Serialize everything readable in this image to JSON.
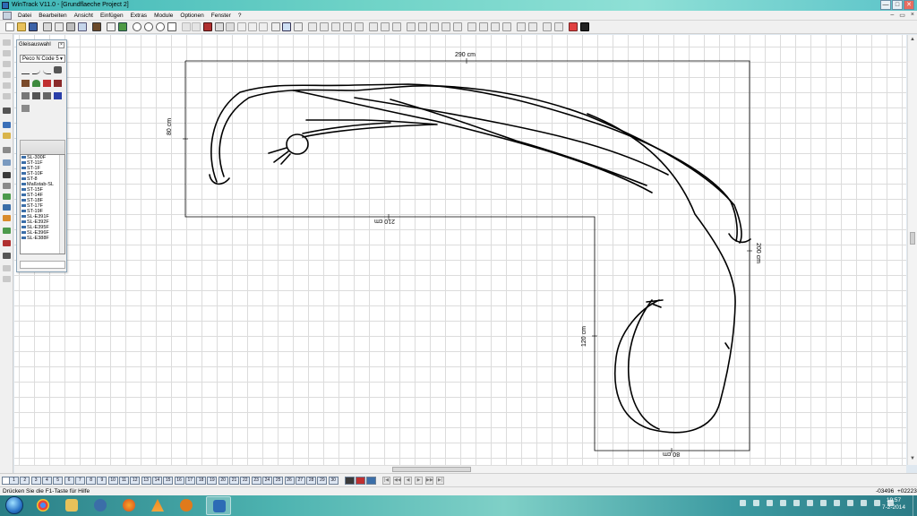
{
  "window": {
    "title": "WinTrack  V11.0 - [Grundflaeche Project 2]",
    "controls": {
      "minimize": "—",
      "maximize": "□",
      "close": "✕"
    }
  },
  "menu": {
    "items": [
      "Datei",
      "Bearbeiten",
      "Ansicht",
      "Einfügen",
      "Extras",
      "Module",
      "Optionen",
      "Fenster",
      "?"
    ],
    "child_controls": {
      "minimize": "–",
      "restore": "▭",
      "close": "×"
    }
  },
  "panel": {
    "title": "Gleisauswahl",
    "close": "×",
    "catalog": "Peco N Code 5",
    "catalog_caret": "▼",
    "track_items": [
      "SL-300F",
      "ST-11F",
      "ST-1F",
      "ST-10F",
      "ST-8",
      "Maßstab-SL",
      "ST-15F",
      "ST-14F",
      "ST-18F",
      "ST-17F",
      "ST-19F",
      "SL-E391F",
      "SL-E392F",
      "SL-E395F",
      "SL-E396F",
      "SL-E388F"
    ]
  },
  "canvas": {
    "dim_top": "290 cm",
    "dim_left": "80 cm",
    "dim_inner": "210 cm",
    "dim_right": "200 cm",
    "dim_leg": "120 cm",
    "dim_bottom": "80 cm"
  },
  "module_tabs": [
    "1",
    "2",
    "3",
    "4",
    "5",
    "6",
    "7",
    "8",
    "9",
    "10",
    "11",
    "12",
    "13",
    "14",
    "15",
    "16",
    "17",
    "18",
    "19",
    "20",
    "21",
    "22",
    "23",
    "24",
    "25",
    "26",
    "27",
    "28",
    "29",
    "30"
  ],
  "scroll_arrows": {
    "up": "▲",
    "down": "▼",
    "grip": "≡",
    "hgrip": "|||"
  },
  "nav_buttons": [
    "|◀",
    "◀◀",
    "◀",
    "▶",
    "▶▶",
    "▶|"
  ],
  "status": {
    "help": "Drücken Sie die  F1-Taste für Hilfe",
    "coord_x": "-03496",
    "coord_y": "+02223"
  },
  "taskbar": {
    "time": "19:57",
    "date": "7-2-2014"
  },
  "colors": {
    "titlebar": "#5cc4c9",
    "taskbar": "#3c9aa1",
    "grid": "#dcdcdc",
    "track_line": "#000000"
  }
}
